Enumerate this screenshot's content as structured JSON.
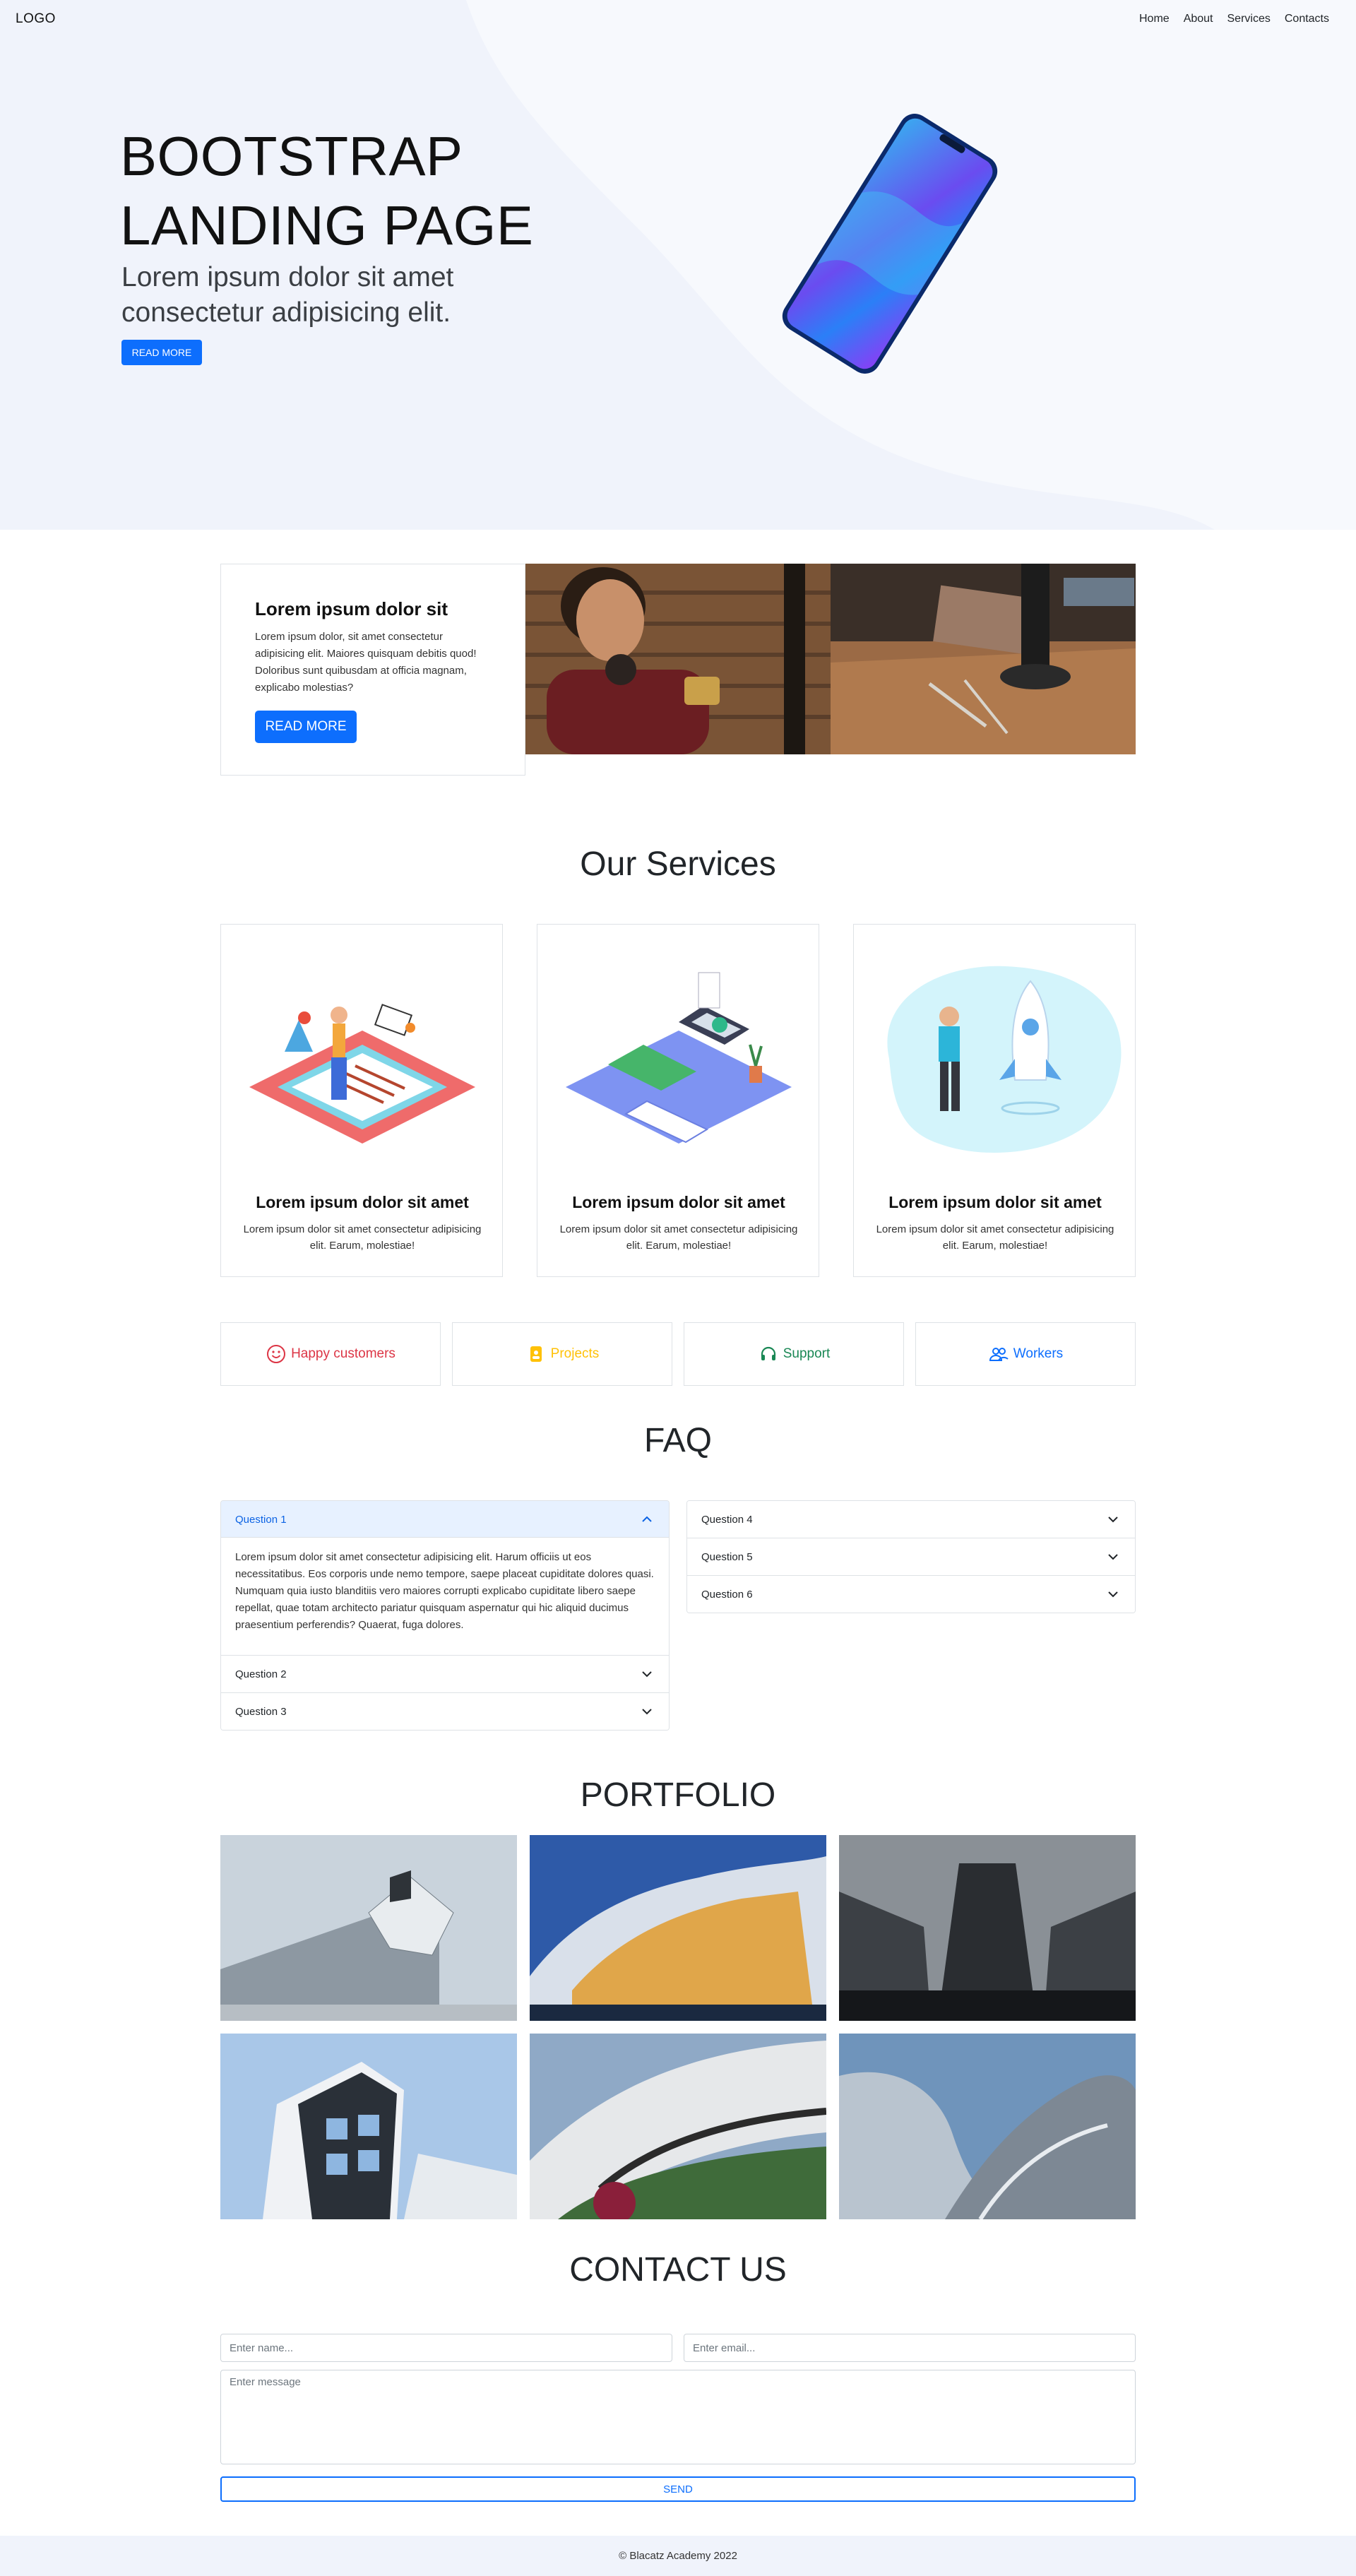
{
  "header": {
    "logo": "LOGO",
    "nav": [
      "Home",
      "About",
      "Services",
      "Contacts"
    ]
  },
  "hero": {
    "title": "BOOTSTRAP LANDING PAGE",
    "subtitle": "Lorem ipsum dolor sit amet consectetur adipisicing elit.",
    "button": "READ MORE"
  },
  "about": {
    "title": "Lorem ipsum dolor sit",
    "body": "Lorem ipsum dolor, sit amet consectetur adipisicing elit. Maiores quisquam debitis quod! Doloribus sunt quibusdam at officia magnam, explicabo molestias?",
    "button": "READ MORE"
  },
  "services": {
    "heading": "Our Services",
    "cards": [
      {
        "title": "Lorem ipsum dolor sit amet",
        "body": "Lorem ipsum dolor sit amet consectetur adipisicing elit. Earum, molestiae!"
      },
      {
        "title": "Lorem ipsum dolor sit amet",
        "body": "Lorem ipsum dolor sit amet consectetur adipisicing elit. Earum, molestiae!"
      },
      {
        "title": "Lorem ipsum dolor sit amet",
        "body": "Lorem ipsum dolor sit amet consectetur adipisicing elit. Earum, molestiae!"
      }
    ]
  },
  "stats": [
    {
      "label": "Happy customers",
      "icon": "smile-icon",
      "color": "#dc3545"
    },
    {
      "label": "Projects",
      "icon": "badge-icon",
      "color": "#ffc107"
    },
    {
      "label": "Support",
      "icon": "headphones-icon",
      "color": "#198754"
    },
    {
      "label": "Workers",
      "icon": "people-icon",
      "color": "#0d6efd"
    }
  ],
  "faq": {
    "heading": "FAQ",
    "left": [
      {
        "q": "Question 1",
        "open": true,
        "a": "Lorem ipsum dolor sit amet consectetur adipisicing elit. Harum officiis ut eos necessitatibus. Eos corporis unde nemo tempore, saepe placeat cupiditate dolores quasi. Numquam quia iusto blanditiis vero maiores corrupti explicabo cupiditate libero saepe repellat, quae totam architecto pariatur quisquam aspernatur qui hic aliquid ducimus praesentium perferendis? Quaerat, fuga dolores."
      },
      {
        "q": "Question 2",
        "open": false
      },
      {
        "q": "Question 3",
        "open": false
      }
    ],
    "right": [
      {
        "q": "Question 4",
        "open": false
      },
      {
        "q": "Question 5",
        "open": false
      },
      {
        "q": "Question 6",
        "open": false
      }
    ]
  },
  "portfolio": {
    "heading": "PORTFOLIO"
  },
  "contact": {
    "heading": "CONTACT US",
    "name_placeholder": "Enter name...",
    "email_placeholder": "Enter email...",
    "message_placeholder": "Enter message",
    "send": "SEND"
  },
  "footer": {
    "text": "© Blacatz Academy 2022"
  },
  "colors": {
    "primary": "#0d6efd",
    "hero_bg": "#f0f3fb"
  }
}
